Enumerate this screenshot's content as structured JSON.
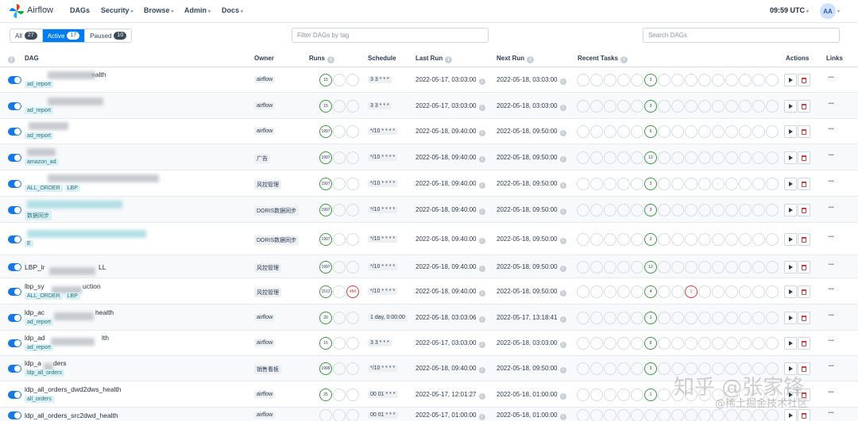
{
  "navbar": {
    "brand": "Airflow",
    "items": [
      "DAGs",
      "Security",
      "Browse",
      "Admin",
      "Docs"
    ],
    "clock": "09:59 UTC",
    "avatar": "AA"
  },
  "filters": {
    "status": [
      {
        "label": "All",
        "count": "27"
      },
      {
        "label": "Active",
        "count": "17"
      },
      {
        "label": "Paused",
        "count": "10"
      }
    ],
    "tag_placeholder": "Filter DAGs by tag",
    "search_placeholder": "Search DAGs"
  },
  "columns": {
    "dag": "DAG",
    "owner": "Owner",
    "runs": "Runs",
    "schedule": "Schedule",
    "last_run": "Last Run",
    "next_run": "Next Run",
    "recent_tasks": "Recent Tasks",
    "actions": "Actions",
    "links": "Links"
  },
  "rows": [
    {
      "name": "ealth",
      "tags": [
        "ad_report"
      ],
      "owner": "airflow",
      "run_success": "15",
      "run_failed": "",
      "schedule": "3 3 * * *",
      "last_run": "2022-05-17, 03:03:00",
      "next_run": "2022-05-18, 03:03:00",
      "task_success": "3",
      "task_failed": ""
    },
    {
      "name": "",
      "tags": [
        "ad_report"
      ],
      "owner": "airflow",
      "run_success": "15",
      "run_failed": "",
      "schedule": "3 3 * * *",
      "last_run": "2022-05-17, 03:03:00",
      "next_run": "2022-05-18, 03:03:00",
      "task_success": "3",
      "task_failed": ""
    },
    {
      "name": "",
      "tags": [
        "ad_report"
      ],
      "owner": "airflow",
      "run_success": "1997",
      "run_failed": "",
      "schedule": "*/10 * * * *",
      "last_run": "2022-05-18, 09:40:00",
      "next_run": "2022-05-18, 09:50:00",
      "task_success": "6",
      "task_failed": ""
    },
    {
      "name": "",
      "tags": [
        "amazon_ad"
      ],
      "owner": "广告",
      "run_success": "1997",
      "run_failed": "",
      "schedule": "*/10 * * * *",
      "last_run": "2022-05-18, 09:40:00",
      "next_run": "2022-05-18, 09:50:00",
      "task_success": "12",
      "task_failed": ""
    },
    {
      "name": "",
      "tags": [
        "ALL_ORDER",
        "LBP"
      ],
      "owner": "风控管理",
      "run_success": "1997",
      "run_failed": "",
      "schedule": "*/10 * * * *",
      "last_run": "2022-05-18, 09:40:00",
      "next_run": "2022-05-18, 09:50:00",
      "task_success": "3",
      "task_failed": ""
    },
    {
      "name": "",
      "tags": [
        "数据同步"
      ],
      "owner": "DORIS数据同步",
      "run_success": "1997",
      "run_failed": "",
      "schedule": "*/10 * * * *",
      "last_run": "2022-05-18, 09:40:00",
      "next_run": "2022-05-18, 09:50:00",
      "task_success": "3",
      "task_failed": ""
    },
    {
      "name": "",
      "tags": [
        "E"
      ],
      "owner": "DORIS数据同步",
      "run_success": "1997",
      "run_failed": "",
      "schedule": "*/10 * * * *",
      "last_run": "2022-05-18, 09:40:00",
      "next_run": "2022-05-18, 09:50:00",
      "task_success": "3",
      "task_failed": ""
    },
    {
      "name": "LBP_lr",
      "name2": "LL",
      "tags": [],
      "owner": "风控管理",
      "run_success": "1997",
      "run_failed": "",
      "schedule": "*/10 * * * *",
      "last_run": "2022-05-18, 09:40:00",
      "next_run": "2022-05-18, 09:50:00",
      "task_success": "12",
      "task_failed": ""
    },
    {
      "name": "lbp_sy",
      "name2": "uction",
      "tags": [
        "ALL_ORDER",
        "LBP"
      ],
      "owner": "风控管理",
      "run_success": "1513",
      "run_failed": "484",
      "schedule": "*/10 * * * *",
      "last_run": "2022-05-18, 09:40:00",
      "next_run": "2022-05-18, 09:50:00",
      "task_success": "4",
      "task_failed": "1"
    },
    {
      "name": "ldp_ac",
      "name2": "health",
      "tags": [
        "ad_report"
      ],
      "owner": "airflow",
      "run_success": "20",
      "run_failed": "",
      "schedule": "1 day, 0:00:00",
      "last_run": "2022-05-18, 03:03:06",
      "next_run": "2022-05-17, 13:18:41",
      "task_success": "1",
      "task_failed": ""
    },
    {
      "name": "ldp_ad",
      "name2": "lth",
      "tags": [
        "ad_report"
      ],
      "owner": "airflow",
      "run_success": "15",
      "run_failed": "",
      "schedule": "3 3 * * *",
      "last_run": "2022-05-17, 03:03:00",
      "next_run": "2022-05-18, 03:03:00",
      "task_success": "8",
      "task_failed": ""
    },
    {
      "name": "ldp_a",
      "name2": "ders",
      "tags": [
        "ldp_all_orders"
      ],
      "owner": "销售看板",
      "run_success": "1999",
      "run_failed": "",
      "schedule": "*/10 * * * *",
      "last_run": "2022-05-18, 09:40:00",
      "next_run": "2022-05-18, 09:50:00",
      "task_success": "3",
      "task_failed": ""
    },
    {
      "name": "ldp_all_orders_dwd2dws_health",
      "tags": [
        "all_orders"
      ],
      "owner": "airflow",
      "run_success": "25",
      "run_failed": "",
      "schedule": "00 01 * * *",
      "last_run": "2022-05-17, 12:01:27",
      "next_run": "2022-05-18, 01:00:00",
      "task_success": "1",
      "task_failed": ""
    },
    {
      "name": "ldp_all_orders_src2dwd_health",
      "tags": [],
      "owner": "airflow",
      "run_success": "",
      "run_failed": "",
      "schedule": "00 01 * * *",
      "last_run": "2022-05-17, 01:00:00",
      "next_run": "2022-05-18, 01:00:00",
      "task_success": "",
      "task_failed": ""
    }
  ],
  "watermark": {
    "line1": "知乎 @张家锋",
    "line2": "@稀土掘金技术社区"
  },
  "colors": {
    "accent": "#017cee",
    "success": "#3a9a3d",
    "failed": "#d63b3b",
    "tag_bg": "#d9f1f4"
  }
}
